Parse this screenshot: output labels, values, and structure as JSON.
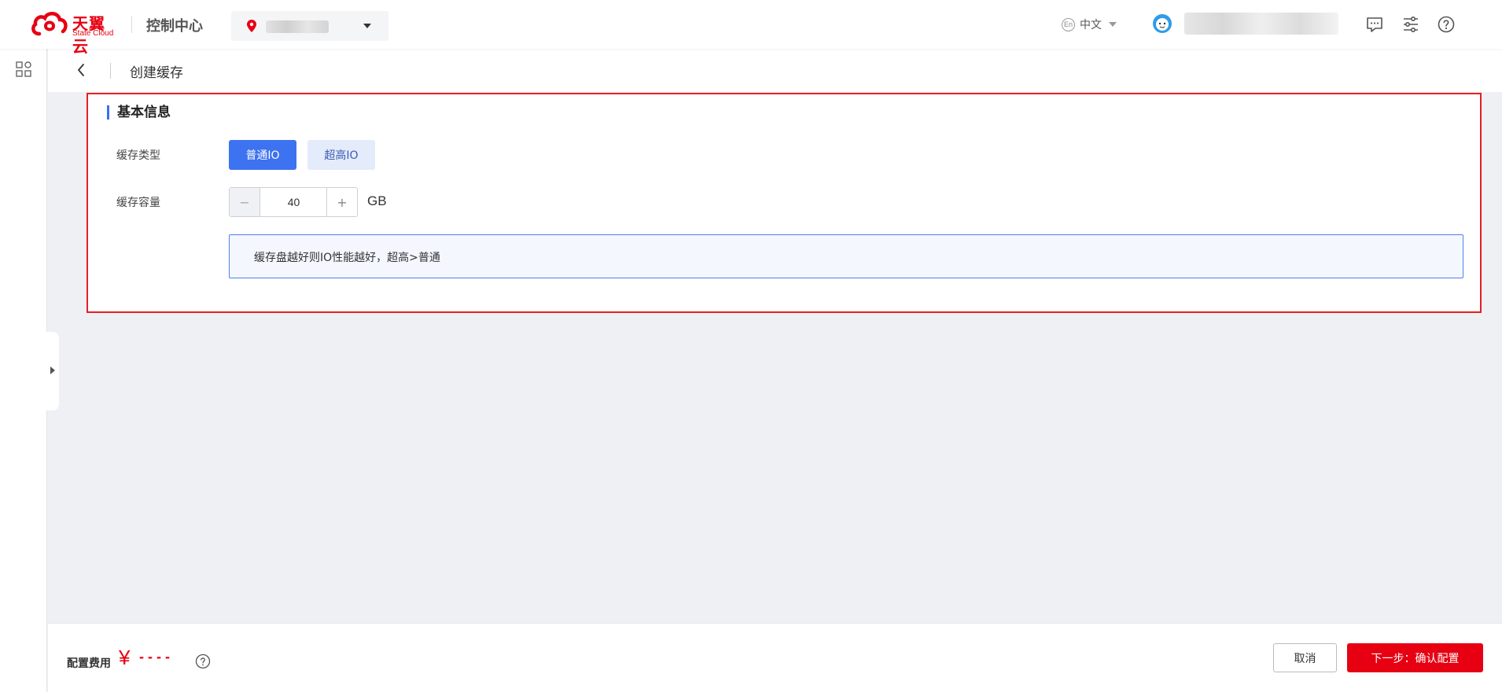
{
  "header": {
    "logo_cn": "天翼云",
    "logo_en": "State Cloud",
    "console_title": "控制中心",
    "language": {
      "badge": "En",
      "label": "中文"
    }
  },
  "page": {
    "title": "创建缓存"
  },
  "basic_info": {
    "section_title": "基本信息",
    "cache_type": {
      "label": "缓存类型",
      "options": [
        "普通IO",
        "超高IO"
      ],
      "selected": "普通IO"
    },
    "cache_capacity": {
      "label": "缓存容量",
      "value": "40",
      "unit": "GB",
      "minus": "−",
      "plus": "+"
    },
    "notice": "缓存盘越好则IO性能越好，超高>普通"
  },
  "footer": {
    "fee_label": "配置费用",
    "currency": "¥",
    "fee_value": "----",
    "cancel_label": "取消",
    "next_label": "下一步：确认配置"
  },
  "colors": {
    "brand_red": "#e60012",
    "accent_blue": "#3d72f0",
    "highlight_border": "#e81e25"
  }
}
